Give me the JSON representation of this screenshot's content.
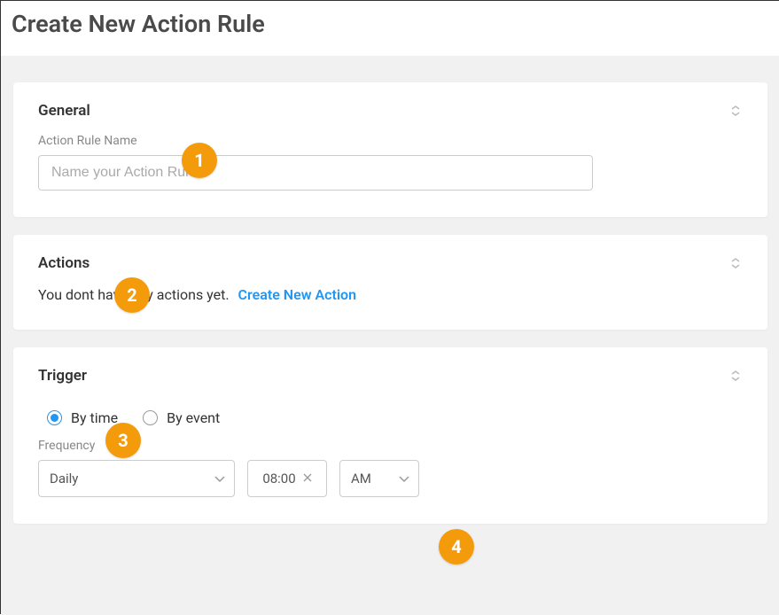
{
  "page": {
    "title": "Create New Action Rule"
  },
  "annotations": [
    "1",
    "2",
    "3",
    "4"
  ],
  "general": {
    "title": "General",
    "nameLabel": "Action Rule Name",
    "namePlaceholder": "Name your Action Rule"
  },
  "actions": {
    "title": "Actions",
    "emptyText": "You dont have any actions yet.",
    "createLink": "Create New Action"
  },
  "trigger": {
    "title": "Trigger",
    "options": {
      "byTime": "By time",
      "byEvent": "By event"
    },
    "frequencyLabel": "Frequency",
    "frequencyValue": "Daily",
    "timeValue": "08:00",
    "ampmValue": "AM"
  }
}
